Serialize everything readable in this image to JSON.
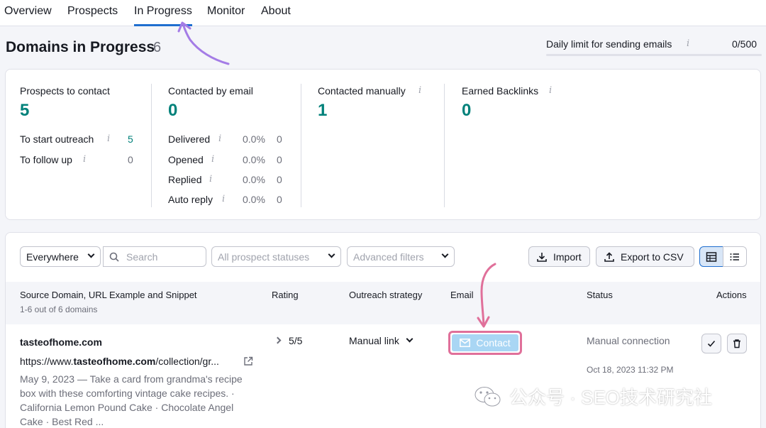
{
  "nav": {
    "tabs": [
      "Overview",
      "Prospects",
      "In Progress",
      "Monitor",
      "About"
    ],
    "active_tab": "In Progress"
  },
  "header": {
    "title": "Domains in Progress",
    "count": "6",
    "daily_limit_label": "Daily limit for sending emails",
    "daily_limit_value": "0/500",
    "daily_limit_fraction": 0
  },
  "stats": {
    "prospects_to_contact": {
      "label": "Prospects to contact",
      "value": "5",
      "rows": [
        {
          "label": "To start outreach",
          "count": "5"
        },
        {
          "label": "To follow up",
          "count": "0"
        }
      ]
    },
    "contacted_by_email": {
      "label": "Contacted by email",
      "value": "0",
      "rows": [
        {
          "label": "Delivered",
          "percent": "0.0%",
          "count": "0"
        },
        {
          "label": "Opened",
          "percent": "0.0%",
          "count": "0"
        },
        {
          "label": "Replied",
          "percent": "0.0%",
          "count": "0"
        },
        {
          "label": "Auto reply",
          "percent": "0.0%",
          "count": "0"
        }
      ]
    },
    "contacted_manually": {
      "label": "Contacted manually",
      "value": "1"
    },
    "earned_backlinks": {
      "label": "Earned Backlinks",
      "value": "0"
    }
  },
  "toolbar": {
    "scope_select": "Everywhere",
    "search_placeholder": "Search",
    "status_filter": "All prospect statuses",
    "advanced_filters": "Advanced filters",
    "import_label": "Import",
    "export_label": "Export to CSV"
  },
  "table": {
    "headers": {
      "source": "Source Domain, URL Example and Snippet",
      "rating": "Rating",
      "strategy": "Outreach strategy",
      "email": "Email",
      "status": "Status",
      "actions": "Actions"
    },
    "subheader": "1-6 out of 6 domains",
    "rows": [
      {
        "domain": "tasteofhome.com",
        "url_prefix": "https://www.",
        "url_bold": "tasteofhome.com",
        "url_suffix": "/collection/gr...",
        "snippet": "May 9, 2023 — Take a card from grandma's recipe box with these comforting vintage cake recipes. · California Lemon Pound Cake · Chocolate Angel Cake · Best Red ...",
        "rating": "5/5",
        "strategy": "Manual link",
        "email_button": "Contact",
        "status": "Manual connection",
        "status_time": "Oct 18, 2023 11:32 PM"
      }
    ]
  },
  "watermark": "公众号 · SEO技术研究社",
  "colors": {
    "accent": "#1f6ecf",
    "teal": "#00817a",
    "annotation_purple": "#a47ce6",
    "annotation_pink": "#e0709a",
    "contact_button": "#a9d6f4"
  }
}
